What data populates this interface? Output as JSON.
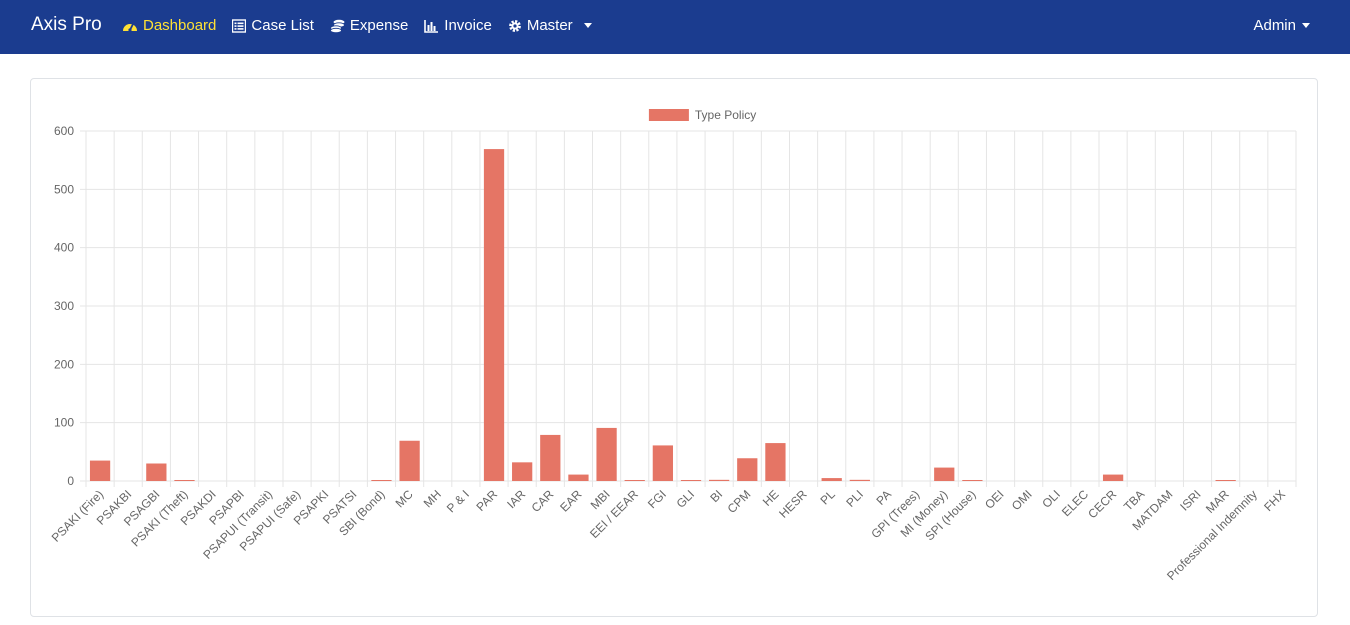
{
  "app": {
    "brand": "Axis Pro"
  },
  "nav": {
    "items": [
      {
        "label": "Dashboard",
        "icon": "gauge-icon",
        "active": true
      },
      {
        "label": "Case List",
        "icon": "list-icon",
        "active": false
      },
      {
        "label": "Expense",
        "icon": "coins-icon",
        "active": false
      },
      {
        "label": "Invoice",
        "icon": "bar-chart-icon",
        "active": false
      },
      {
        "label": "Master",
        "icon": "gear-icon",
        "active": false,
        "dropdown": true
      }
    ],
    "user_label": "Admin"
  },
  "colors": {
    "navbar": "#1b3c8f",
    "active_nav": "#ffe135",
    "bar": "#e57565"
  },
  "chart_data": {
    "type": "bar",
    "legend": "Type Policy",
    "legend_position": "top",
    "grid": true,
    "ylim": [
      0,
      600
    ],
    "yticks": [
      0,
      100,
      200,
      300,
      400,
      500,
      600
    ],
    "categories": [
      "PSAKI (Fire)",
      "PSAKBI",
      "PSAGBI",
      "PSAKI (Theft)",
      "PSAKDI",
      "PSAPBI",
      "PSAPUI (Transit)",
      "PSAPUI (Safe)",
      "PSAPKI",
      "PSATSI",
      "SBI (Bond)",
      "MC",
      "MH",
      "P & I",
      "PAR",
      "IAR",
      "CAR",
      "EAR",
      "MBI",
      "EEI / EEAR",
      "FGI",
      "GLI",
      "BI",
      "CPM",
      "HE",
      "HESR",
      "PL",
      "PLI",
      "PA",
      "GPI (Trees)",
      "MI (Money)",
      "SPI (House)",
      "OEI",
      "OMI",
      "OLI",
      "ELEC",
      "CECR",
      "TBA",
      "MATDAM",
      "ISRI",
      "MAR",
      "Professional Indemnity",
      "FHX"
    ],
    "values": [
      35,
      0,
      30,
      1,
      0,
      0,
      0,
      0,
      0,
      0,
      1,
      69,
      0,
      0,
      569,
      32,
      79,
      11,
      91,
      1,
      61,
      1,
      2,
      39,
      65,
      0,
      5,
      2,
      0,
      0,
      23,
      1,
      0,
      0,
      0,
      0,
      11,
      0,
      0,
      0,
      1,
      0,
      0
    ]
  }
}
